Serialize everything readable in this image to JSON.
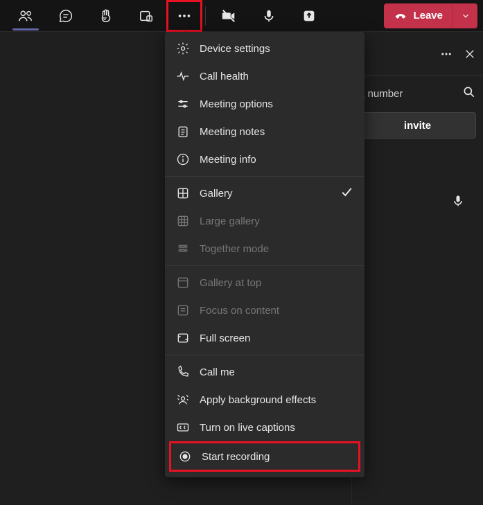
{
  "topbar": {
    "leave_label": "Leave"
  },
  "side": {
    "number_hint": "a number",
    "invite_label": "invite"
  },
  "menu": {
    "sections": [
      {
        "items": [
          {
            "key": "device_settings",
            "label": "Device settings"
          },
          {
            "key": "call_health",
            "label": "Call health"
          },
          {
            "key": "meeting_options",
            "label": "Meeting options"
          },
          {
            "key": "meeting_notes",
            "label": "Meeting notes"
          },
          {
            "key": "meeting_info",
            "label": "Meeting info"
          }
        ]
      },
      {
        "items": [
          {
            "key": "gallery",
            "label": "Gallery",
            "checked": true
          },
          {
            "key": "large_gallery",
            "label": "Large gallery",
            "disabled": true
          },
          {
            "key": "together_mode",
            "label": "Together mode",
            "disabled": true
          }
        ]
      },
      {
        "items": [
          {
            "key": "gallery_at_top",
            "label": "Gallery at top",
            "disabled": true
          },
          {
            "key": "focus_on_content",
            "label": "Focus on content",
            "disabled": true
          },
          {
            "key": "full_screen",
            "label": "Full screen"
          }
        ]
      },
      {
        "items": [
          {
            "key": "call_me",
            "label": "Call me"
          },
          {
            "key": "apply_background_effects",
            "label": "Apply background effects"
          },
          {
            "key": "turn_on_live_captions",
            "label": "Turn on live captions"
          },
          {
            "key": "start_recording",
            "label": "Start recording",
            "highlight": true
          }
        ]
      }
    ]
  }
}
